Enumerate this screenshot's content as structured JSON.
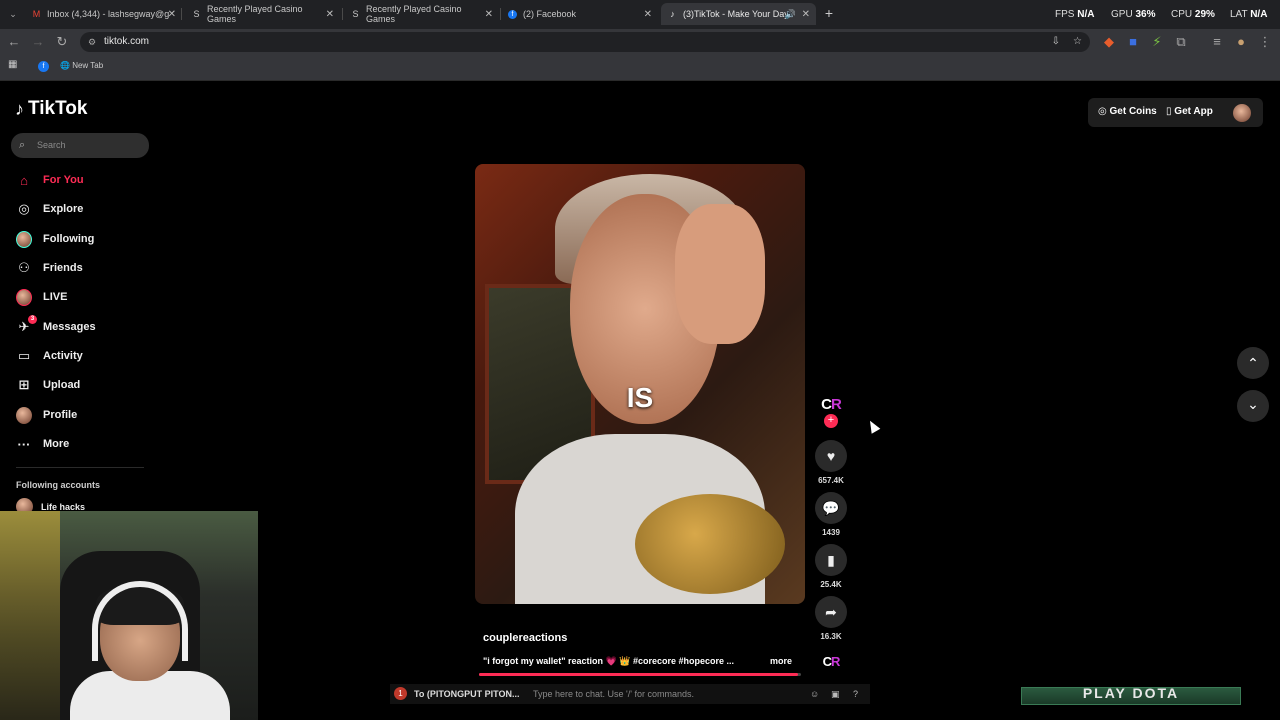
{
  "browser": {
    "tabs": [
      {
        "title": "Inbox (4,344) - lashsegway@g",
        "icon": "gmail-icon"
      },
      {
        "title": "Recently Played Casino Games",
        "icon": "stake-icon"
      },
      {
        "title": "Recently Played Casino Games",
        "icon": "stake-icon"
      },
      {
        "title": "(2) Facebook",
        "icon": "facebook-icon"
      },
      {
        "title": "(3)TikTok - Make Your Day",
        "icon": "tiktok-icon"
      }
    ],
    "stats": {
      "fps_label": "FPS",
      "fps": "N/A",
      "gpu_label": "GPU",
      "gpu": "36",
      "cpu_label": "CPU",
      "cpu": "29",
      "lat_label": "LAT",
      "lat": "N/A"
    },
    "url": "tiktok.com",
    "bookmarks": {
      "newtab": "New Tab"
    }
  },
  "tiktok": {
    "logo": "TikTok",
    "search_placeholder": "Search",
    "nav": [
      {
        "label": "For You"
      },
      {
        "label": "Explore"
      },
      {
        "label": "Following"
      },
      {
        "label": "Friends"
      },
      {
        "label": "LIVE"
      },
      {
        "label": "Messages",
        "badge": "3"
      },
      {
        "label": "Activity"
      },
      {
        "label": "Upload"
      },
      {
        "label": "Profile"
      },
      {
        "label": "More"
      }
    ],
    "following_title": "Following accounts",
    "following_accounts": [
      {
        "name": "Life hacks"
      }
    ],
    "top_buttons": {
      "coins": "Get Coins",
      "app": "Get App"
    },
    "video": {
      "overlay_word": "IS",
      "author": "couplereactions",
      "description": "\"i forgot my wallet\" reaction 💗 👑 #corecore #hopecore ...",
      "more": "more",
      "progress_fraction": 0.99,
      "creator_initials": [
        "C",
        "R"
      ]
    },
    "actions": {
      "likes": "657.4K",
      "comments": "1439",
      "saves": "25.4K",
      "shares": "16.3K"
    }
  },
  "chat": {
    "count": "1",
    "to": "To (PITONGPUT PITON...",
    "placeholder": "Type here to chat. Use '/' for commands."
  },
  "game_banner": "PLAY DOTA"
}
